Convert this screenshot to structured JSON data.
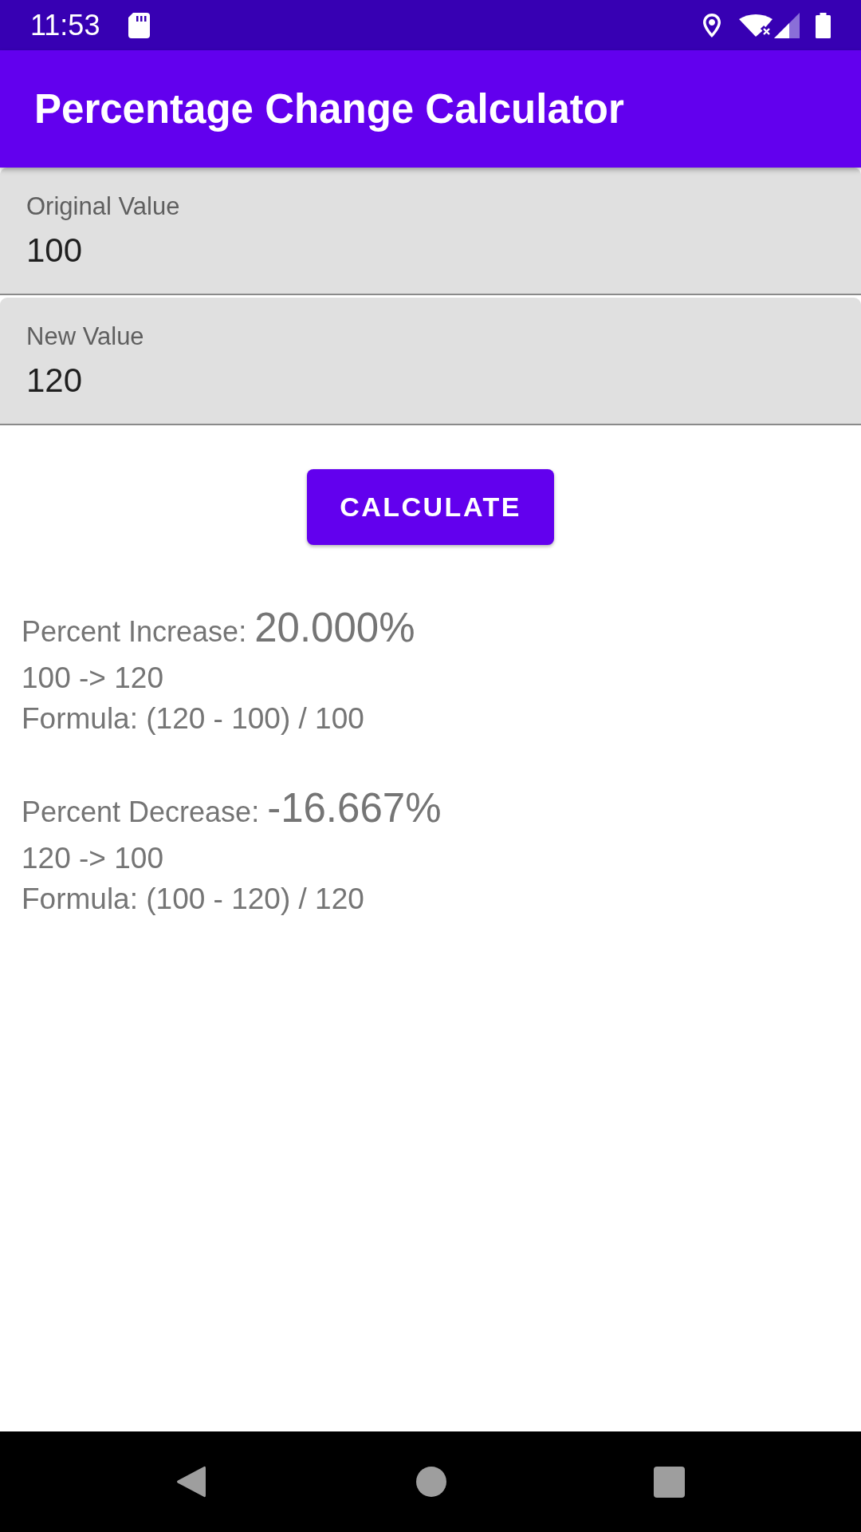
{
  "status_bar": {
    "time": "11:53"
  },
  "app_bar": {
    "title": "Percentage Change Calculator"
  },
  "fields": [
    {
      "label": "Original Value",
      "value": "100"
    },
    {
      "label": "New Value",
      "value": "120"
    }
  ],
  "calculate_button": {
    "label": "CALCULATE"
  },
  "results": [
    {
      "label": "Percent Increase:",
      "value": "20.000%",
      "change": "100 -> 120",
      "formula": "Formula: (120 - 100) / 100"
    },
    {
      "label": "Percent Decrease:",
      "value": "-16.667%",
      "change": "120 -> 100",
      "formula": "Formula: (100 - 120) / 120"
    }
  ]
}
